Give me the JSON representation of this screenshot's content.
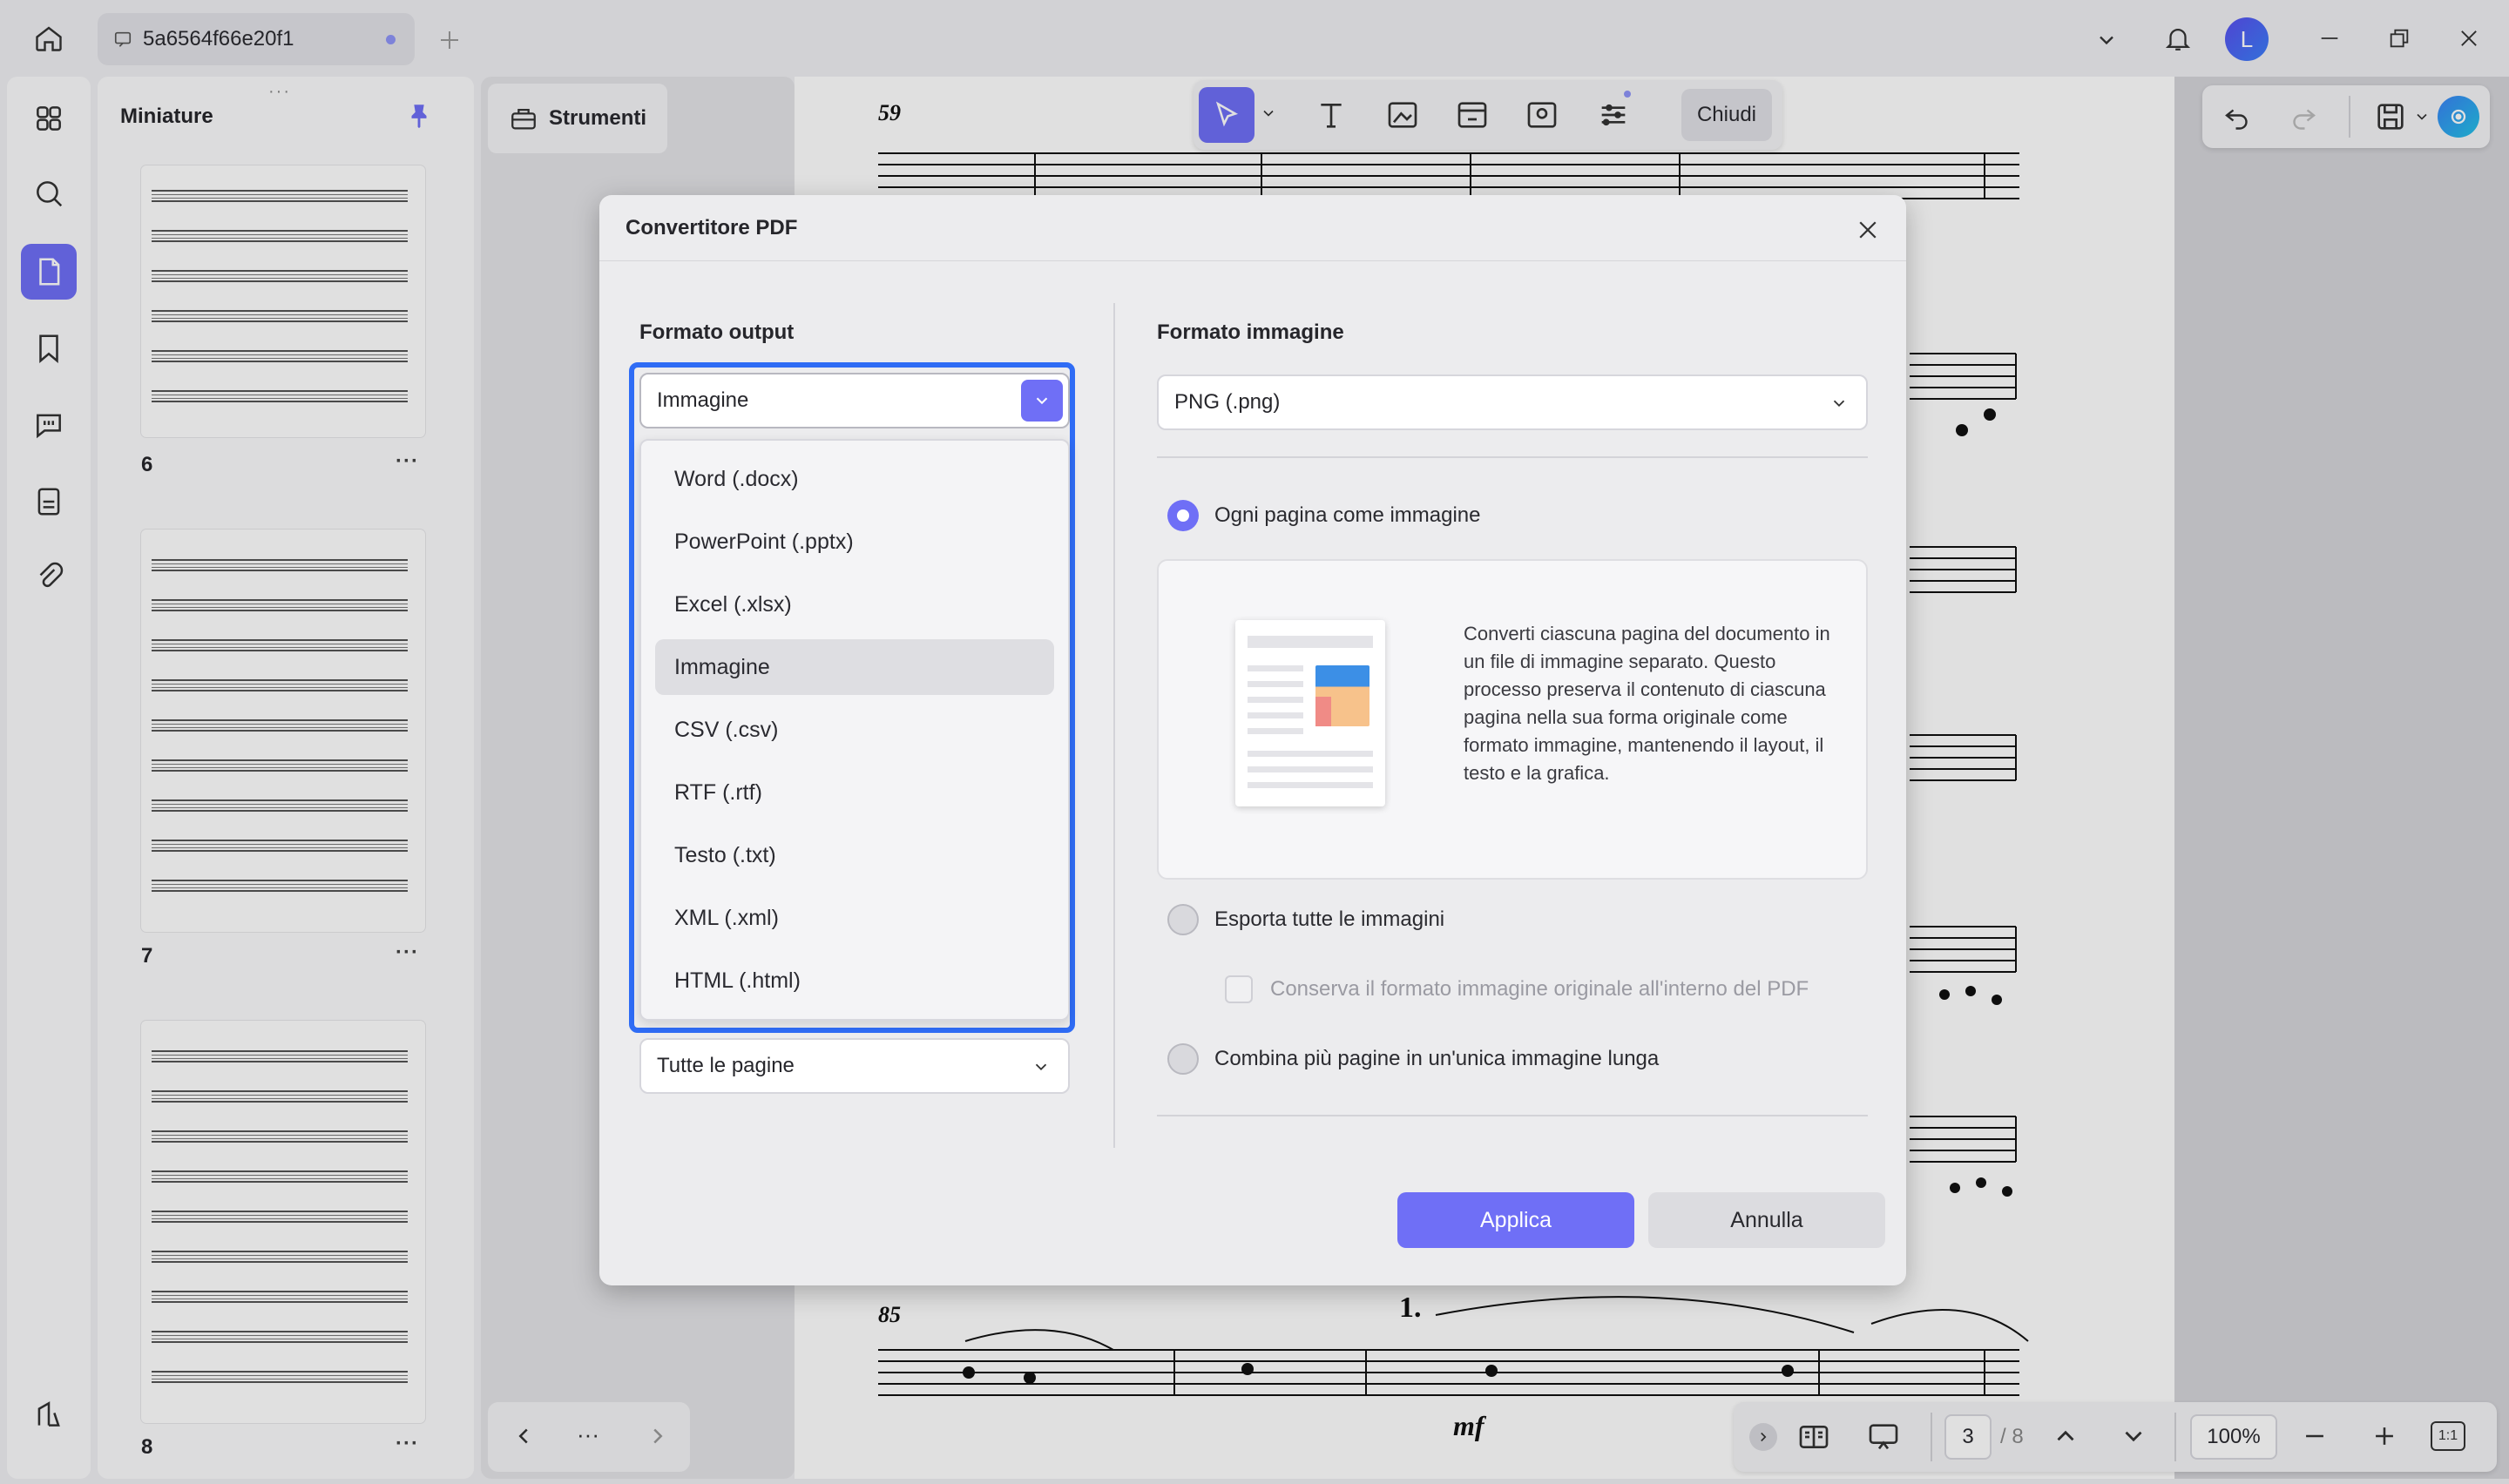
{
  "window": {
    "tab_title": "5a6564f66e20f1",
    "user_initial": "L"
  },
  "thumbnails": {
    "title": "Miniature",
    "pages": [
      {
        "number": "6",
        "more": "···"
      },
      {
        "number": "7",
        "more": "···"
      },
      {
        "number": "8",
        "more": "···"
      }
    ]
  },
  "tools": {
    "label": "Strumenti",
    "nav_more": "···"
  },
  "edit_toolbar": {
    "close_label": "Chiudi"
  },
  "score": {
    "measure_59": "59",
    "measure_85": "85",
    "ending_1": "1.",
    "dynamic": "mf"
  },
  "bottom_toolbar": {
    "current_page": "3",
    "total_pages": "/ 8",
    "zoom": "100%",
    "fit_label": "1:1"
  },
  "dialog": {
    "title": "Convertitore PDF",
    "output_format_label": "Formato output",
    "output_format_value": "Immagine",
    "format_options": [
      "Word (.docx)",
      "PowerPoint (.pptx)",
      "Excel (.xlsx)",
      "Immagine",
      "CSV (.csv)",
      "RTF (.rtf)",
      "Testo (.txt)",
      "XML (.xml)",
      "HTML (.html)"
    ],
    "page_range_value": "Tutte le pagine",
    "image_format_label": "Formato immagine",
    "image_format_value": "PNG (.png)",
    "option_each_page": "Ogni pagina come immagine",
    "info_text": "Converti ciascuna pagina del documento in un file di immagine separato. Questo processo preserva il contenuto di ciascuna pagina nella sua forma originale come formato immagine, mantenendo il layout, il testo e la grafica.",
    "option_export_images": "Esporta tutte le immagini",
    "option_keep_format": "Conserva il formato immagine originale all'interno del PDF",
    "option_combine": "Combina più pagine in un'unica immagine lunga",
    "apply_label": "Applica",
    "cancel_label": "Annulla"
  },
  "colors": {
    "accent": "#6f6ff6",
    "focus_ring": "#2f6cf5"
  }
}
